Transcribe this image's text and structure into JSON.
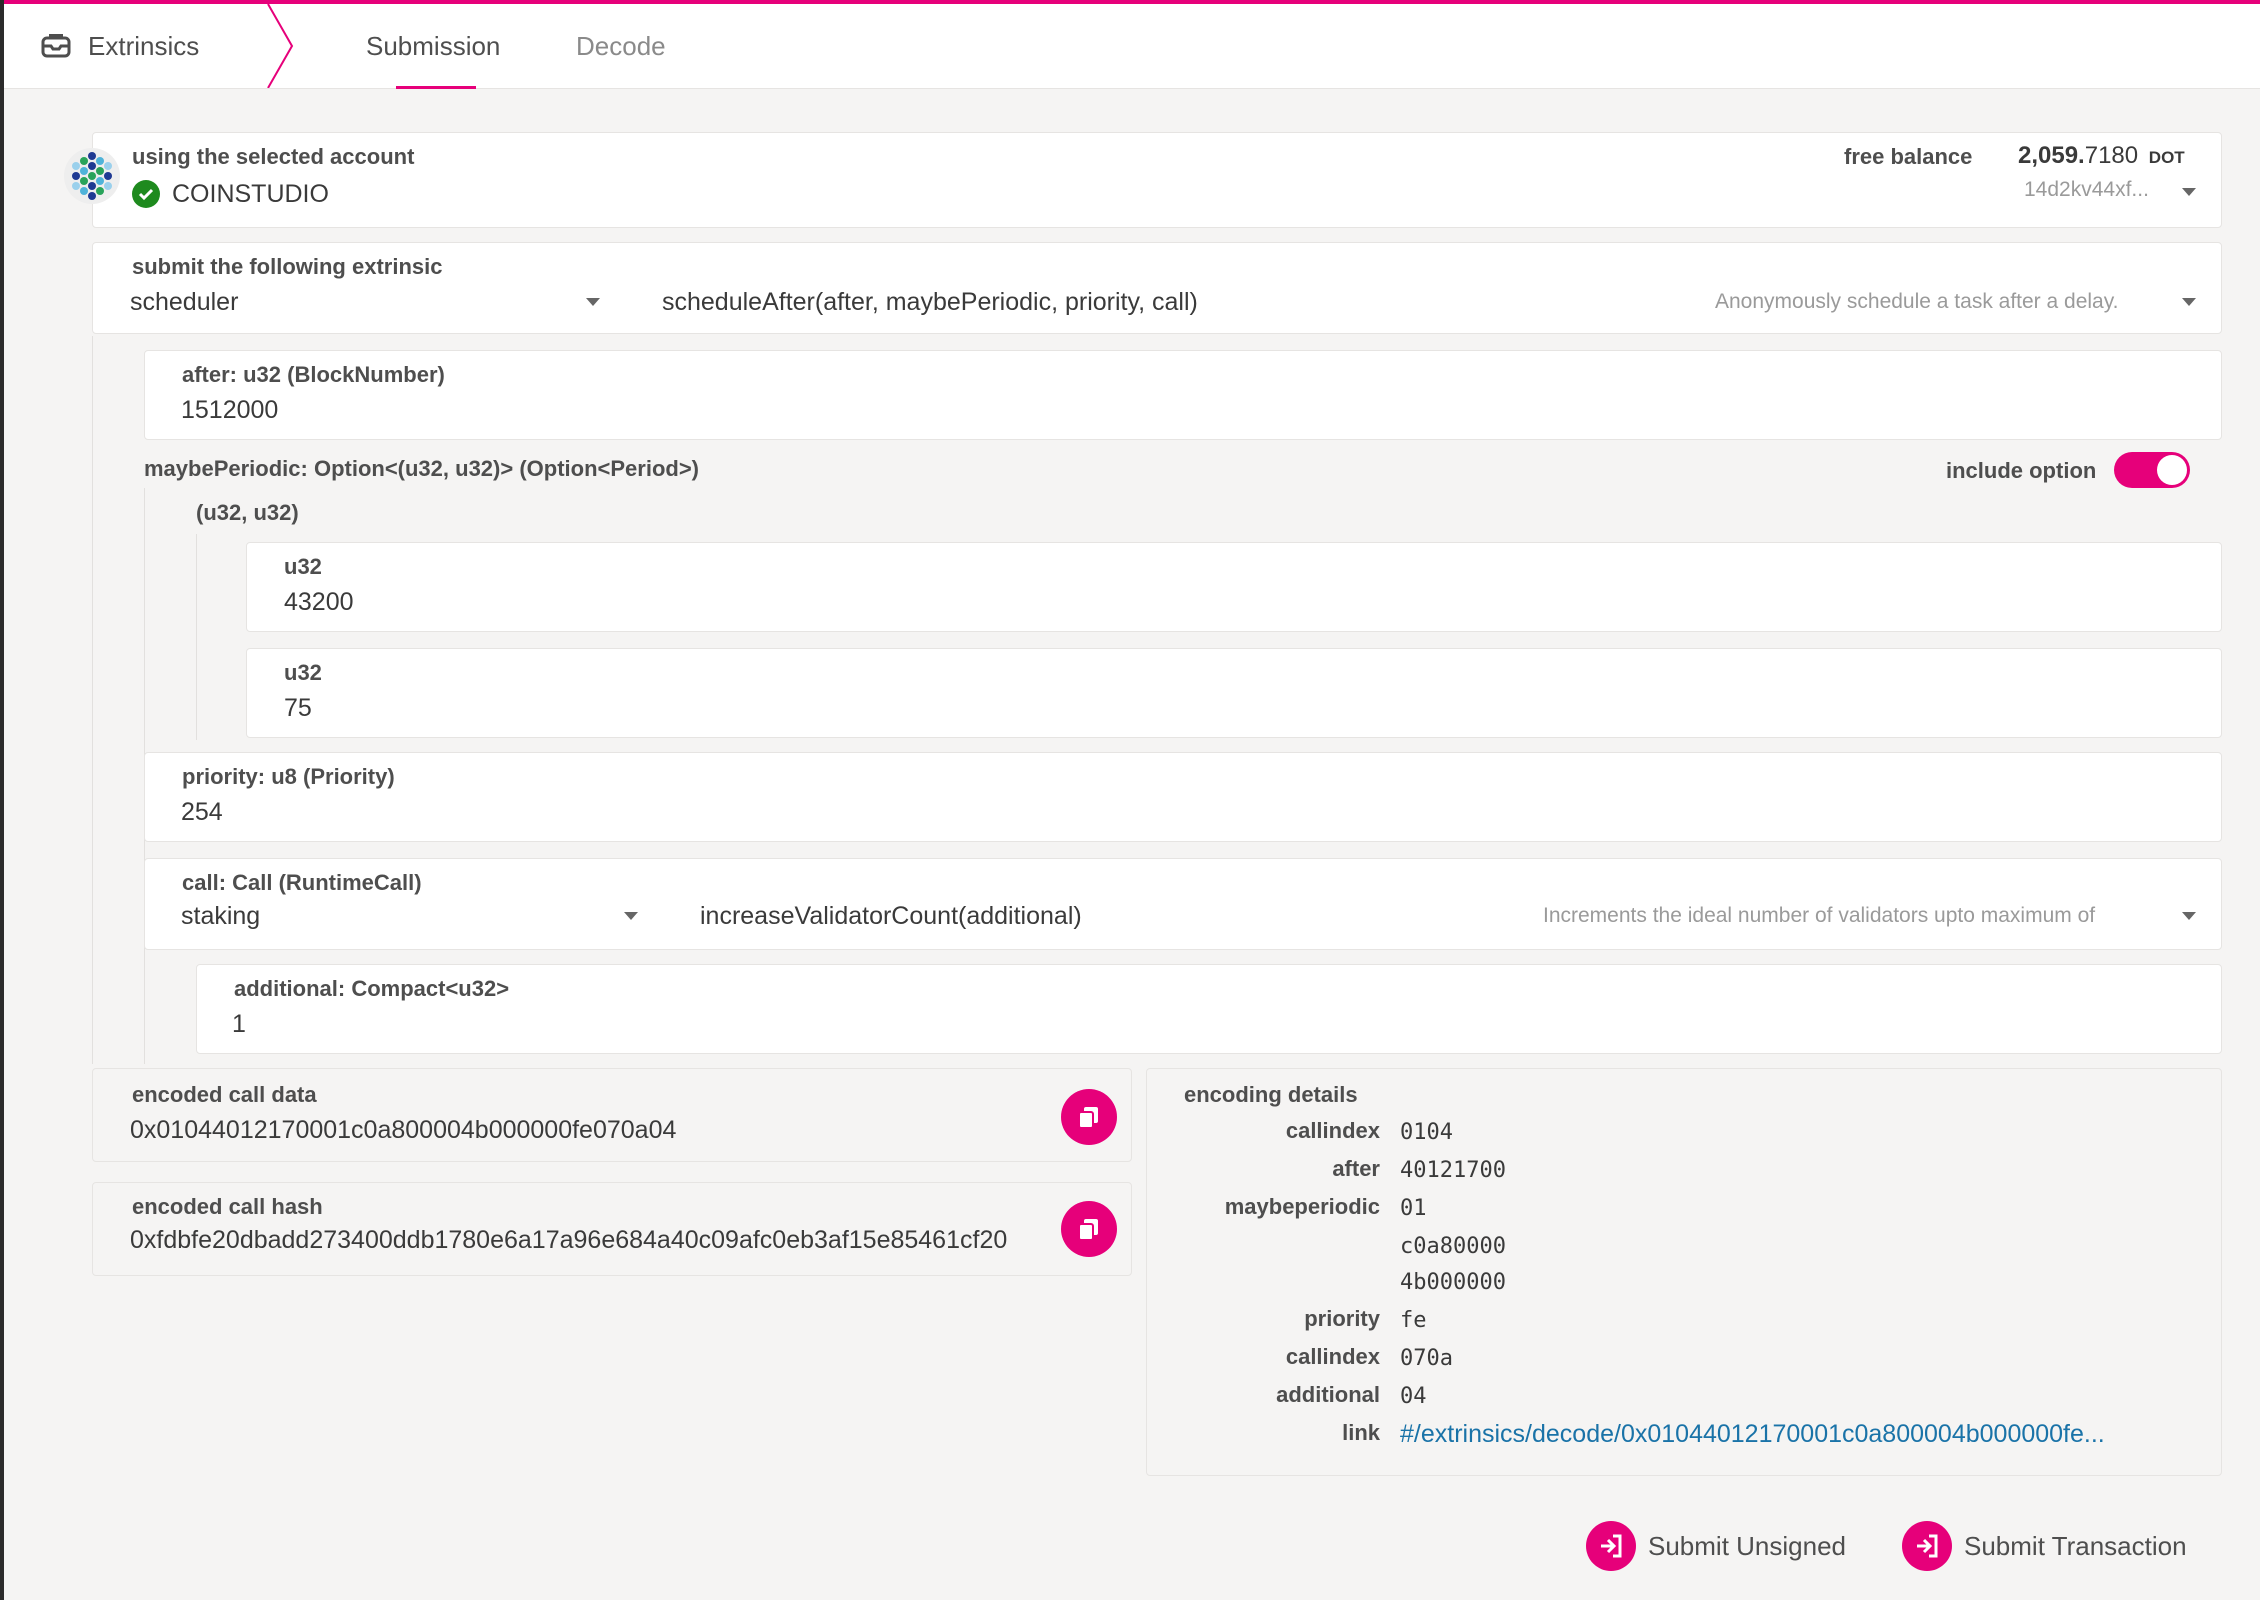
{
  "header": {
    "breadcrumb": "Extrinsics",
    "tabs": [
      {
        "label": "Submission",
        "active": true
      },
      {
        "label": "Decode",
        "active": false
      }
    ]
  },
  "account": {
    "label": "using the selected account",
    "name": "COINSTUDIO",
    "balance_label": "free balance",
    "balance_int": "2,059.",
    "balance_frac": "7180",
    "balance_unit": "DOT",
    "address": "14d2kv44xf..."
  },
  "extrinsic": {
    "label": "submit the following extrinsic",
    "section": "scheduler",
    "method": "scheduleAfter(after, maybePeriodic, priority, call)",
    "description": "Anonymously schedule a task after a delay."
  },
  "params": {
    "after_label": "after: u32 (BlockNumber)",
    "after_value": "1512000",
    "maybe_periodic_label": "maybePeriodic: Option<(u32, u32)> (Option<Period>)",
    "include_option_label": "include option",
    "tuple_label": "(u32, u32)",
    "tuple_items": [
      {
        "label": "u32",
        "value": "43200"
      },
      {
        "label": "u32",
        "value": "75"
      }
    ],
    "priority_label": "priority: u8 (Priority)",
    "priority_value": "254",
    "call_label": "call: Call (RuntimeCall)",
    "call_section": "staking",
    "call_method": "increaseValidatorCount(additional)",
    "call_description": "Increments the ideal number of validators upto maximum of",
    "additional_label": "additional: Compact<u32>",
    "additional_value": "1"
  },
  "encoded": {
    "call_data_label": "encoded call data",
    "call_data": "0x01044012170001c0a800004b000000fe070a04",
    "call_hash_label": "encoded call hash",
    "call_hash": "0xfdbfe20dbadd273400ddb1780e6a17a96e684a40c09afc0eb3af15e85461cf20"
  },
  "encoding_details": {
    "title": "encoding details",
    "rows": [
      {
        "key": "callindex",
        "value": "0104"
      },
      {
        "key": "after",
        "value": "40121700"
      },
      {
        "key": "maybeperiodic",
        "value": "01"
      },
      {
        "key": "",
        "value": "c0a80000"
      },
      {
        "key": "",
        "value": "4b000000"
      },
      {
        "key": "priority",
        "value": "fe"
      },
      {
        "key": "callindex",
        "value": "070a"
      },
      {
        "key": "additional",
        "value": "04"
      }
    ],
    "link_key": "link",
    "link_value": "#/extrinsics/decode/0x01044012170001c0a800004b000000fe..."
  },
  "actions": {
    "submit_unsigned": "Submit Unsigned",
    "submit_transaction": "Submit Transaction"
  },
  "colors": {
    "accent": "#e6007a",
    "link": "#1a73a8",
    "success": "#1e8a1e"
  }
}
